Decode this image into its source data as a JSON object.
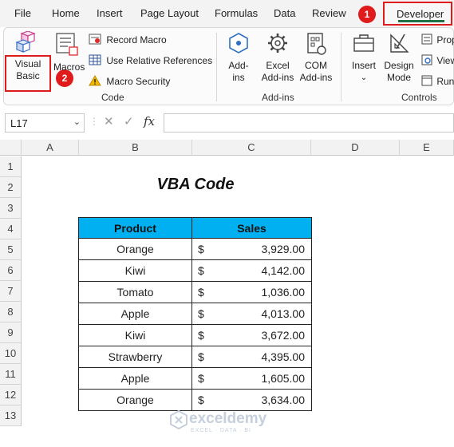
{
  "menu": {
    "tabs": [
      "File",
      "Home",
      "Insert",
      "Page Layout",
      "Formulas",
      "Data",
      "Review"
    ],
    "active_tab": "Developer"
  },
  "callouts": {
    "step1": "1",
    "step2": "2"
  },
  "ribbon": {
    "code": {
      "visual_basic": [
        "Visual",
        "Basic"
      ],
      "macros": "Macros",
      "record_macro": "Record Macro",
      "relative_refs": "Use Relative References",
      "macro_security": "Macro Security",
      "group_label": "Code"
    },
    "addins": {
      "addins": [
        "Add-",
        "ins"
      ],
      "excel_addins": [
        "Excel",
        "Add-ins"
      ],
      "com_addins": [
        "COM",
        "Add-ins"
      ],
      "group_label": "Add-ins"
    },
    "controls": {
      "insert": "Insert",
      "design_mode": [
        "Design",
        "Mode"
      ],
      "properties": "Prop",
      "view_code": "View",
      "run_dialog": "Run",
      "group_label": "Controls"
    }
  },
  "formula_bar": {
    "name_box": "L17",
    "fx": "fx",
    "formula": ""
  },
  "grid": {
    "columns": [
      "A",
      "B",
      "C",
      "D",
      "E"
    ],
    "rows": [
      "1",
      "2",
      "3",
      "4",
      "5",
      "6",
      "7",
      "8",
      "9",
      "10",
      "11",
      "12",
      "13"
    ]
  },
  "sheet": {
    "title": "VBA Code",
    "headers": [
      "Product",
      "Sales"
    ],
    "currency_symbol": "$",
    "rows": [
      {
        "product": "Orange",
        "sales": "3,929.00"
      },
      {
        "product": "Kiwi",
        "sales": "4,142.00"
      },
      {
        "product": "Tomato",
        "sales": "1,036.00"
      },
      {
        "product": "Apple",
        "sales": "4,013.00"
      },
      {
        "product": "Kiwi",
        "sales": "3,672.00"
      },
      {
        "product": "Strawberry",
        "sales": "4,395.00"
      },
      {
        "product": "Apple",
        "sales": "1,605.00"
      },
      {
        "product": "Orange",
        "sales": "3,634.00"
      }
    ]
  },
  "watermark": {
    "name": "exceldemy",
    "tagline": "EXCEL · DATA · BI"
  },
  "colors": {
    "accent": "#00b0f0",
    "highlight": "#e01b1b",
    "excel_green": "#1e7145"
  }
}
